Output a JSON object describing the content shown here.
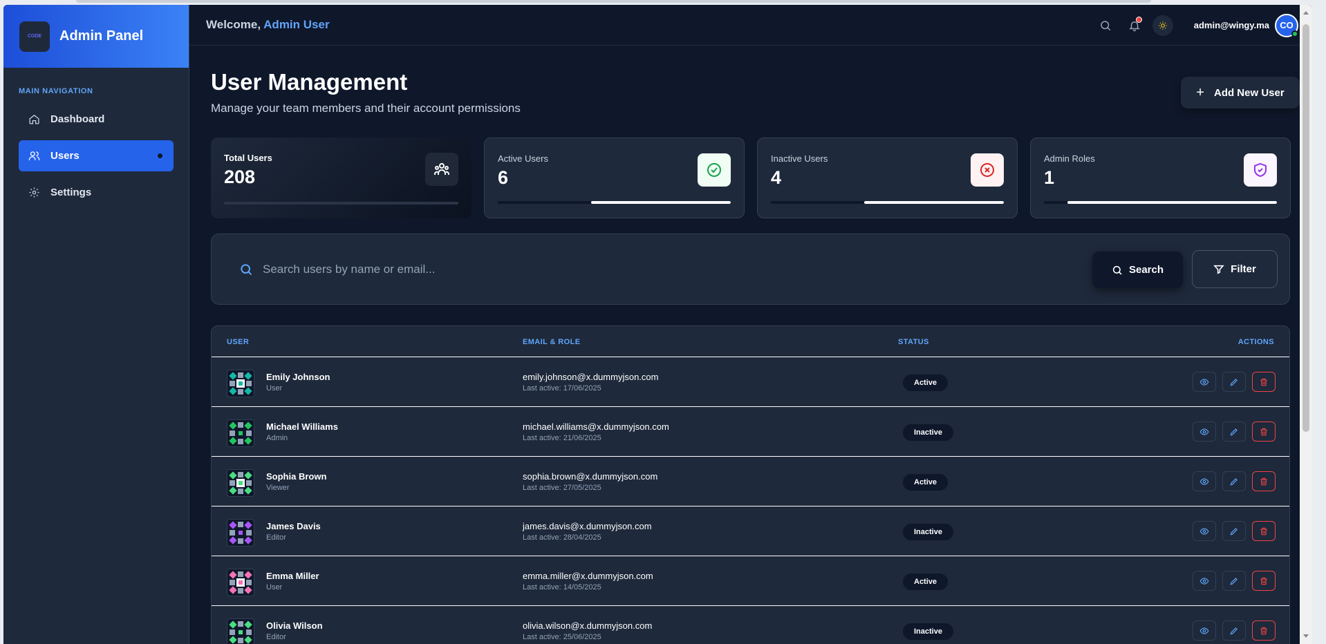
{
  "brand": {
    "logo_text": "CODE",
    "title": "Admin Panel"
  },
  "sidebar": {
    "heading": "MAIN NAVIGATION",
    "items": [
      {
        "label": "Dashboard",
        "icon": "home-icon",
        "active": false
      },
      {
        "label": "Users",
        "icon": "users-icon",
        "active": true
      },
      {
        "label": "Settings",
        "icon": "gear-icon",
        "active": false
      }
    ]
  },
  "header": {
    "welcome_prefix": "Welcome,",
    "welcome_name": "Admin User",
    "email": "admin@wingy.ma",
    "avatar_initials": "CO"
  },
  "page": {
    "title": "User Management",
    "subtitle": "Manage your team members and their account permissions",
    "add_button": "Add New User"
  },
  "stats": [
    {
      "label": "Total Users",
      "value": "208",
      "icon": "users-group-icon",
      "progress": 0.0
    },
    {
      "label": "Active Users",
      "value": "6",
      "icon": "check-circle-icon",
      "progress": 0.6
    },
    {
      "label": "Inactive Users",
      "value": "4",
      "icon": "x-circle-icon",
      "progress": 0.6
    },
    {
      "label": "Admin Roles",
      "value": "1",
      "icon": "shield-check-icon",
      "progress": 0.9
    }
  ],
  "search": {
    "placeholder": "Search users by name or email...",
    "value": "",
    "search_button": "Search",
    "filter_button": "Filter"
  },
  "table": {
    "columns": [
      "USER",
      "EMAIL & ROLE",
      "STATUS",
      "ACTIONS"
    ],
    "rows": [
      {
        "name": "Emily Johnson",
        "role": "User",
        "email": "emily.johnson@x.dummyjson.com",
        "last_active": "Last active: 17/06/2025",
        "status": "Active"
      },
      {
        "name": "Michael Williams",
        "role": "Admin",
        "email": "michael.williams@x.dummyjson.com",
        "last_active": "Last active: 21/06/2025",
        "status": "Inactive"
      },
      {
        "name": "Sophia Brown",
        "role": "Viewer",
        "email": "sophia.brown@x.dummyjson.com",
        "last_active": "Last active: 27/05/2025",
        "status": "Active"
      },
      {
        "name": "James Davis",
        "role": "Editor",
        "email": "james.davis@x.dummyjson.com",
        "last_active": "Last active: 28/04/2025",
        "status": "Inactive"
      },
      {
        "name": "Emma Miller",
        "role": "User",
        "email": "emma.miller@x.dummyjson.com",
        "last_active": "Last active: 14/05/2025",
        "status": "Active"
      },
      {
        "name": "Olivia Wilson",
        "role": "Editor",
        "email": "olivia.wilson@x.dummyjson.com",
        "last_active": "Last active: 25/06/2025",
        "status": "Inactive"
      }
    ]
  },
  "colors": {
    "accent": "#3b82f6",
    "background": "#0f172a",
    "card": "#1e293b",
    "danger": "#ef4444",
    "success": "#22c55e"
  }
}
